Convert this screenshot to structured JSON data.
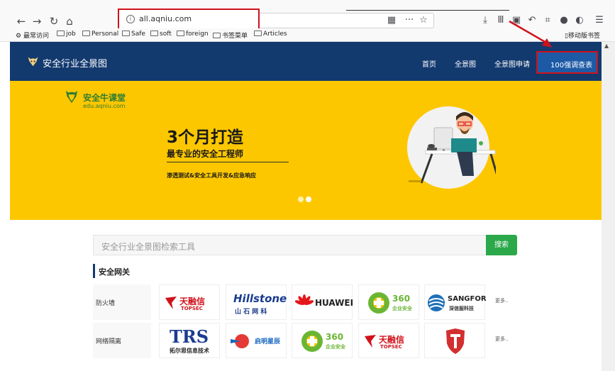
{
  "browser": {
    "url": "all.aqniu.com",
    "url_info_glyph": "i",
    "bookmarks": [
      "最常访问",
      "job",
      "Personal",
      "Safe",
      "soft",
      "foreign",
      "书签菜单",
      "Articles"
    ],
    "mobile_bookmarks": "移动版书签"
  },
  "header": {
    "site_title": "安全行业全景图",
    "nav": [
      "首页",
      "全景图",
      "全景图申请",
      "100强调查表"
    ]
  },
  "banner": {
    "edu_name": "安全牛课堂",
    "edu_url": "edu.aqniu.com",
    "headline": "3个月打造",
    "subline": "最专业的安全工程师",
    "tagline": "渗透测试&安全工具开发&应急响应"
  },
  "search": {
    "placeholder": "安全行业全景图检索工具",
    "button": "搜索"
  },
  "section": {
    "title": "安全网关",
    "rows": [
      {
        "label": "防火墙",
        "more": "更多.."
      },
      {
        "label": "网络隔离",
        "more": "更多.."
      }
    ],
    "logos": {
      "topsec_cn": "天融信",
      "topsec_en": "TOPSEC",
      "hillstone": "Hillstone",
      "hillstone_cn": "山 石 网 科",
      "huawei": "HUAWEI",
      "q360": "360",
      "q360_sub": "企业安全",
      "sangfor": "SANGFOR",
      "sangfor_cn": "深信服科技",
      "trs": "TRS",
      "trs_cn": "拓尔思信息技术",
      "qiming": "启明星辰"
    }
  },
  "colors": {
    "header": "#133a6f",
    "banner": "#fdc700",
    "search_button": "#2ba84a",
    "annotation": "#d0121b"
  }
}
